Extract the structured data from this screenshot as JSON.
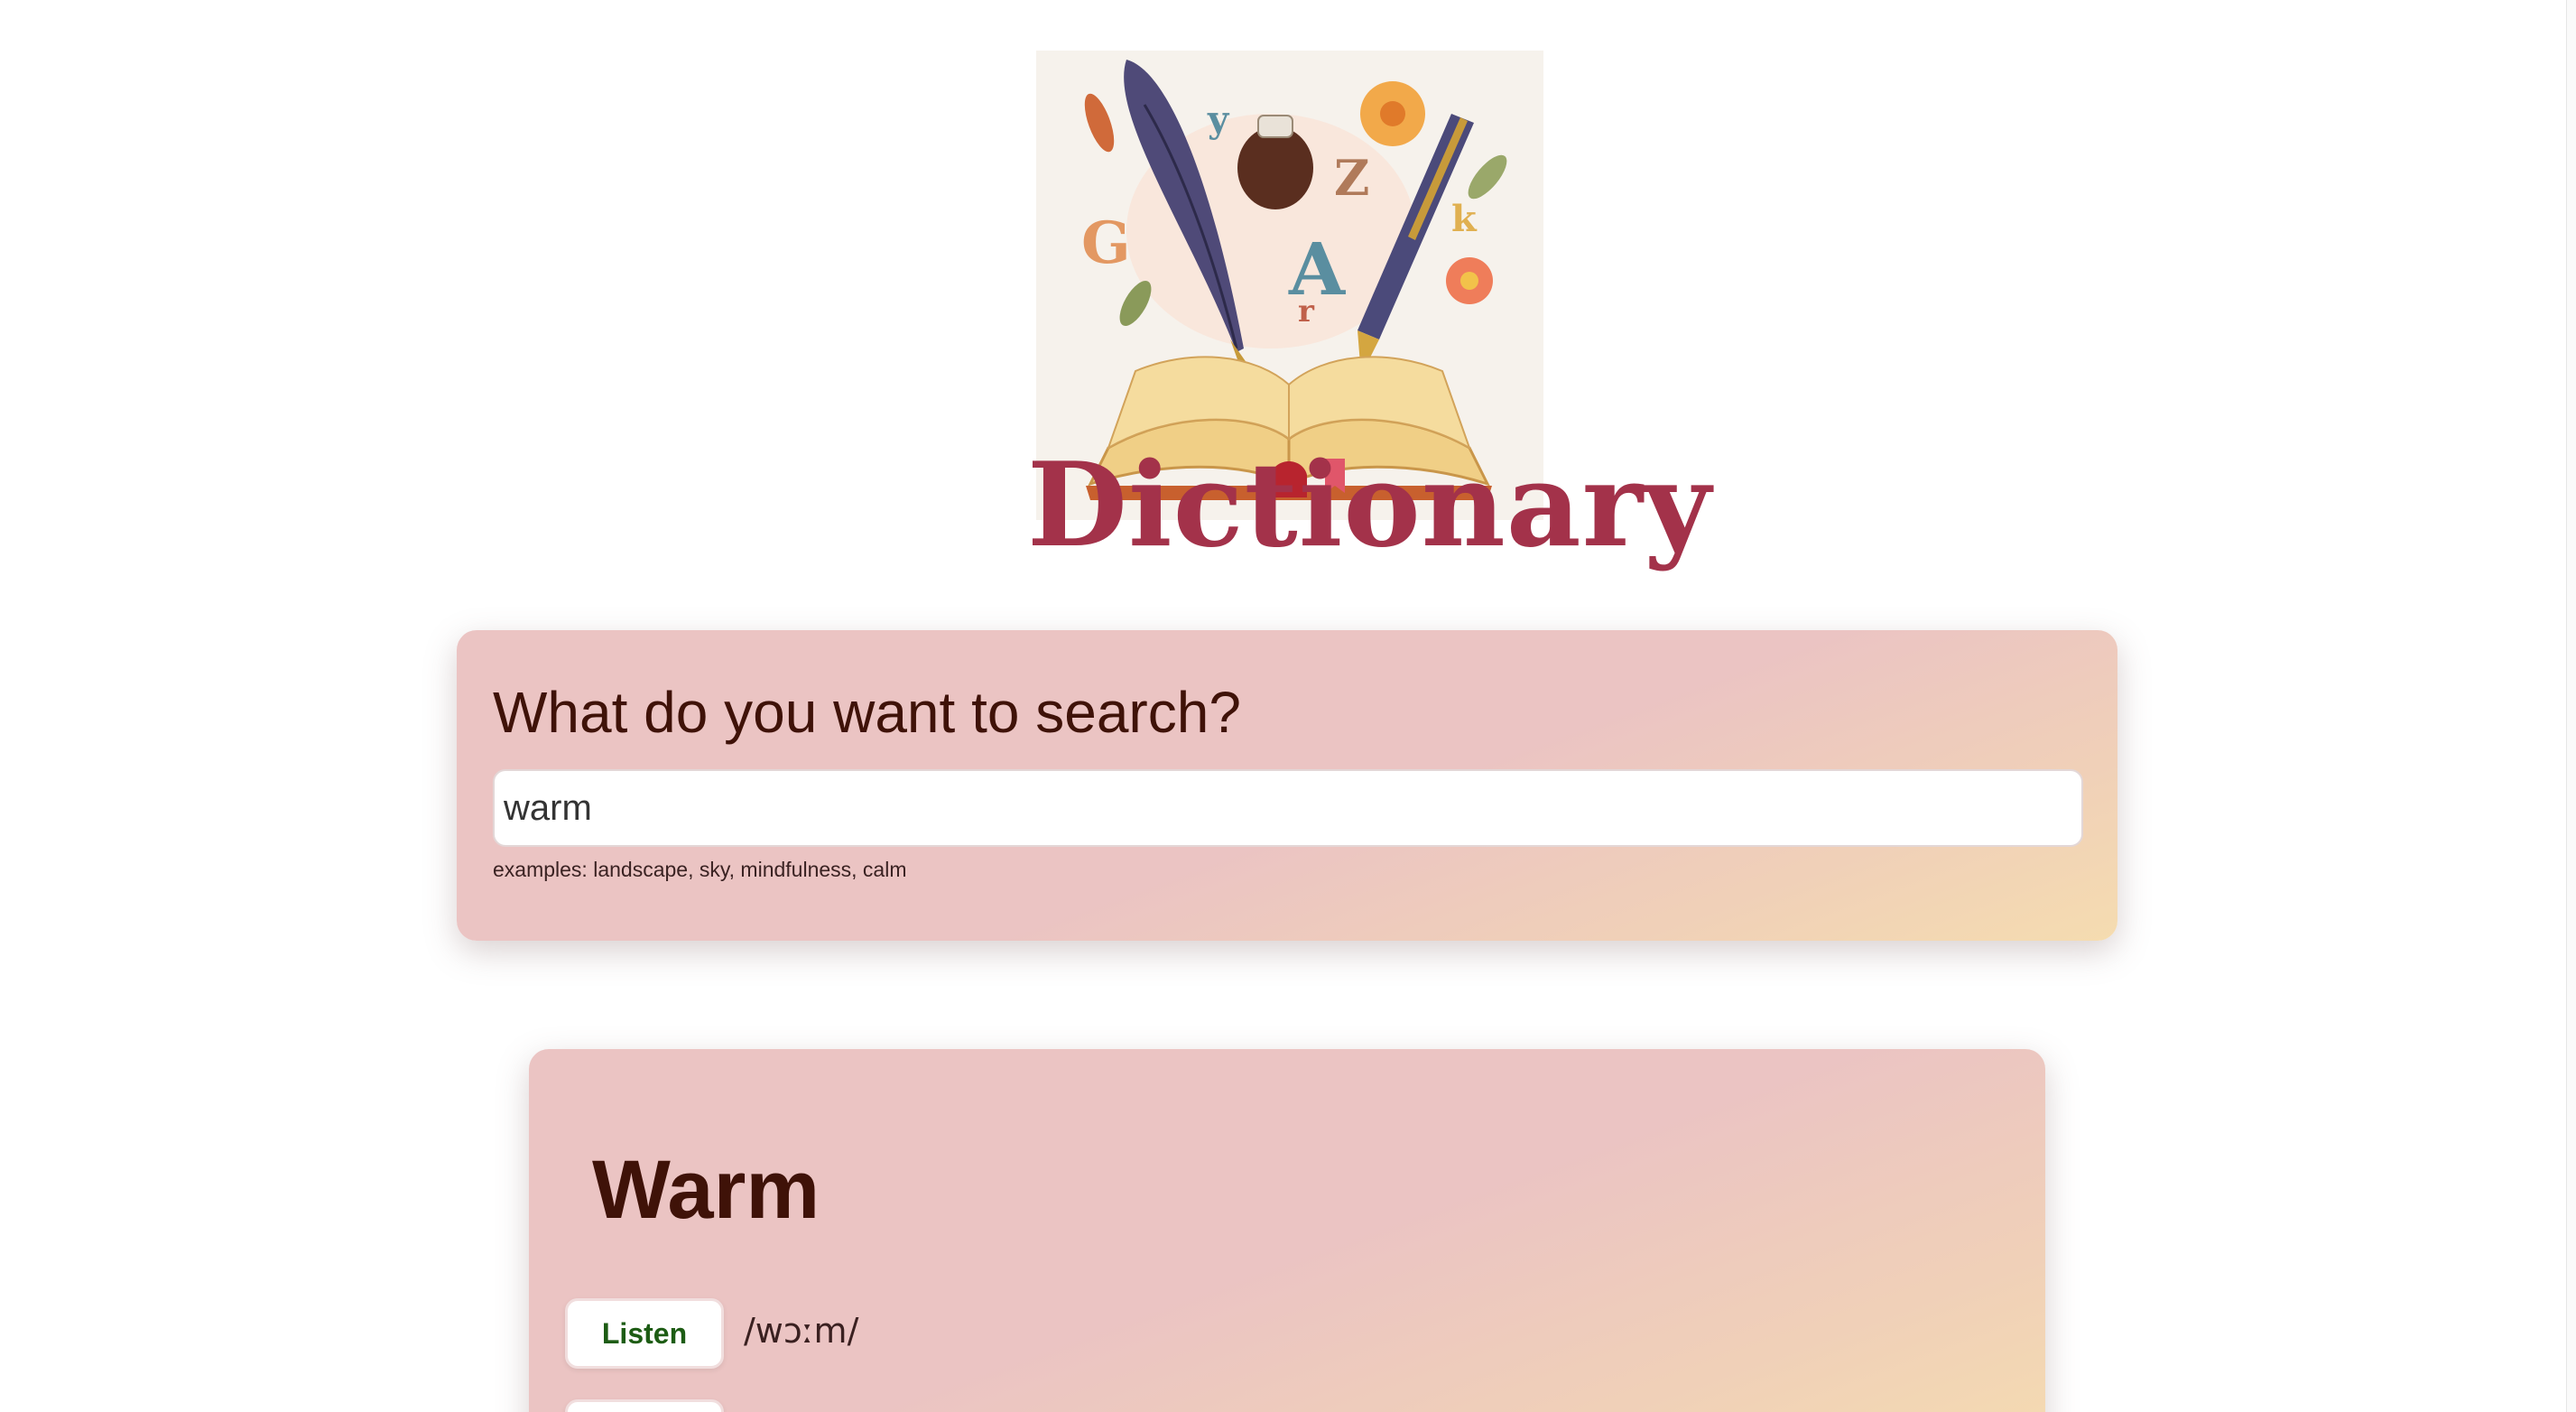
{
  "app": {
    "logo_text": "Dictionary"
  },
  "search": {
    "heading": "What do you want to search?",
    "value": "warm",
    "hint": "examples: landscape, sky, mindfulness, calm"
  },
  "result": {
    "word": "Warm",
    "listen_label": "Listen",
    "phonetic": "/wɔːm/"
  },
  "colors": {
    "brand": "#a3324a",
    "heading_text": "#3f1208",
    "listen_text": "#1d5c14",
    "card_gradient_start": "#ebc4c3",
    "card_gradient_end": "#f5dcb0"
  },
  "icons": {
    "logo_illustration": "open-book-quill-pen-icon"
  }
}
